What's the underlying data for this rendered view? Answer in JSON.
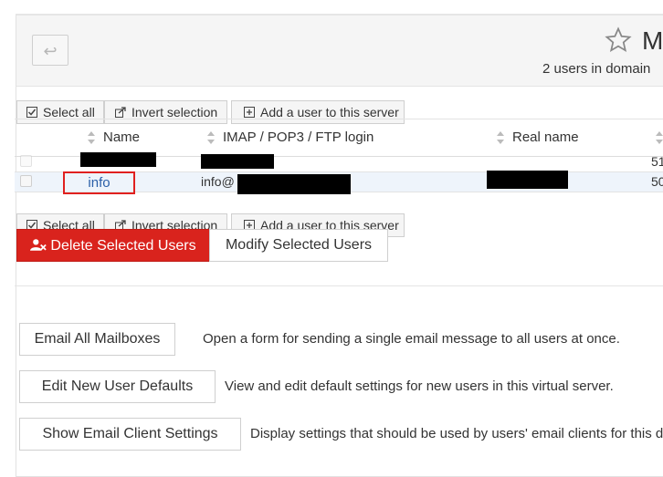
{
  "header": {
    "back_icon": "↩",
    "title": "M",
    "subtitle": "2 users in domain"
  },
  "toolbar": {
    "select_all": "Select all",
    "invert_selection": "Invert selection",
    "add_user": "Add a user to this server"
  },
  "table": {
    "columns": [
      "Name",
      "IMAP / POP3 / FTP login",
      "Real name"
    ],
    "rows": [
      {
        "name": "",
        "login": "",
        "quota_partial": "51"
      },
      {
        "name": "info",
        "login": "info@",
        "quota_partial": "50"
      }
    ]
  },
  "actions": {
    "delete_label": "Delete Selected Users",
    "modify_label": "Modify Selected Users"
  },
  "forms": [
    {
      "button": "Email All Mailboxes",
      "description": "Open a form for sending a single email message to all users at once."
    },
    {
      "button": "Edit New User Defaults",
      "description": "View and edit default settings for new users in this virtual server."
    },
    {
      "button": "Show Email Client Settings",
      "description": "Display settings that should be used by users' email clients for this do"
    }
  ],
  "colors": {
    "danger": "#d9231d",
    "link": "#2a5fa8",
    "highlight_box": "#e0201f",
    "selected_row": "#eef4fb"
  }
}
